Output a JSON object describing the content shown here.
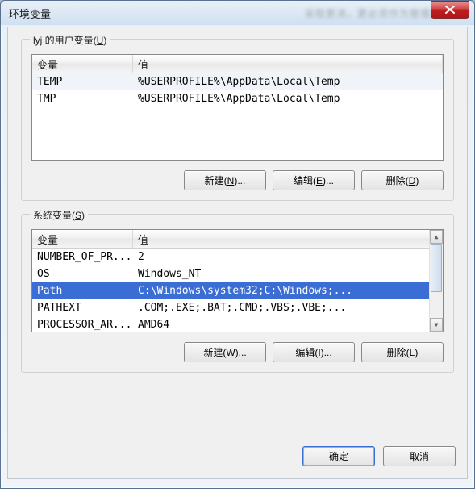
{
  "window": {
    "title": "环境变量",
    "close_icon": "close-icon"
  },
  "userVars": {
    "groupTitle": "lyj 的用户变量",
    "groupAccel": "U",
    "headers": {
      "name": "变量",
      "value": "值"
    },
    "rows": [
      {
        "name": "TEMP",
        "value": "%USERPROFILE%\\AppData\\Local\\Temp",
        "selected": true
      },
      {
        "name": "TMP",
        "value": "%USERPROFILE%\\AppData\\Local\\Temp",
        "selected": false
      }
    ],
    "buttons": {
      "new": {
        "label": "新建",
        "accel": "N",
        "suffix": "..."
      },
      "edit": {
        "label": "编辑",
        "accel": "E",
        "suffix": "..."
      },
      "delete": {
        "label": "删除",
        "accel": "D",
        "suffix": ""
      }
    }
  },
  "sysVars": {
    "groupTitle": "系统变量",
    "groupAccel": "S",
    "headers": {
      "name": "变量",
      "value": "值"
    },
    "rows": [
      {
        "name": "NUMBER_OF_PR...",
        "value": "2",
        "selected": false
      },
      {
        "name": "OS",
        "value": "Windows_NT",
        "selected": false
      },
      {
        "name": "Path",
        "value": "C:\\Windows\\system32;C:\\Windows;...",
        "selected": true
      },
      {
        "name": "PATHEXT",
        "value": ".COM;.EXE;.BAT;.CMD;.VBS;.VBE;...",
        "selected": false
      },
      {
        "name": "PROCESSOR_AR...",
        "value": "AMD64",
        "selected": false
      }
    ],
    "buttons": {
      "new": {
        "label": "新建",
        "accel": "W",
        "suffix": "..."
      },
      "edit": {
        "label": "编辑",
        "accel": "I",
        "suffix": "..."
      },
      "delete": {
        "label": "删除",
        "accel": "L",
        "suffix": ""
      }
    }
  },
  "dialog": {
    "ok": "确定",
    "cancel": "取消"
  }
}
